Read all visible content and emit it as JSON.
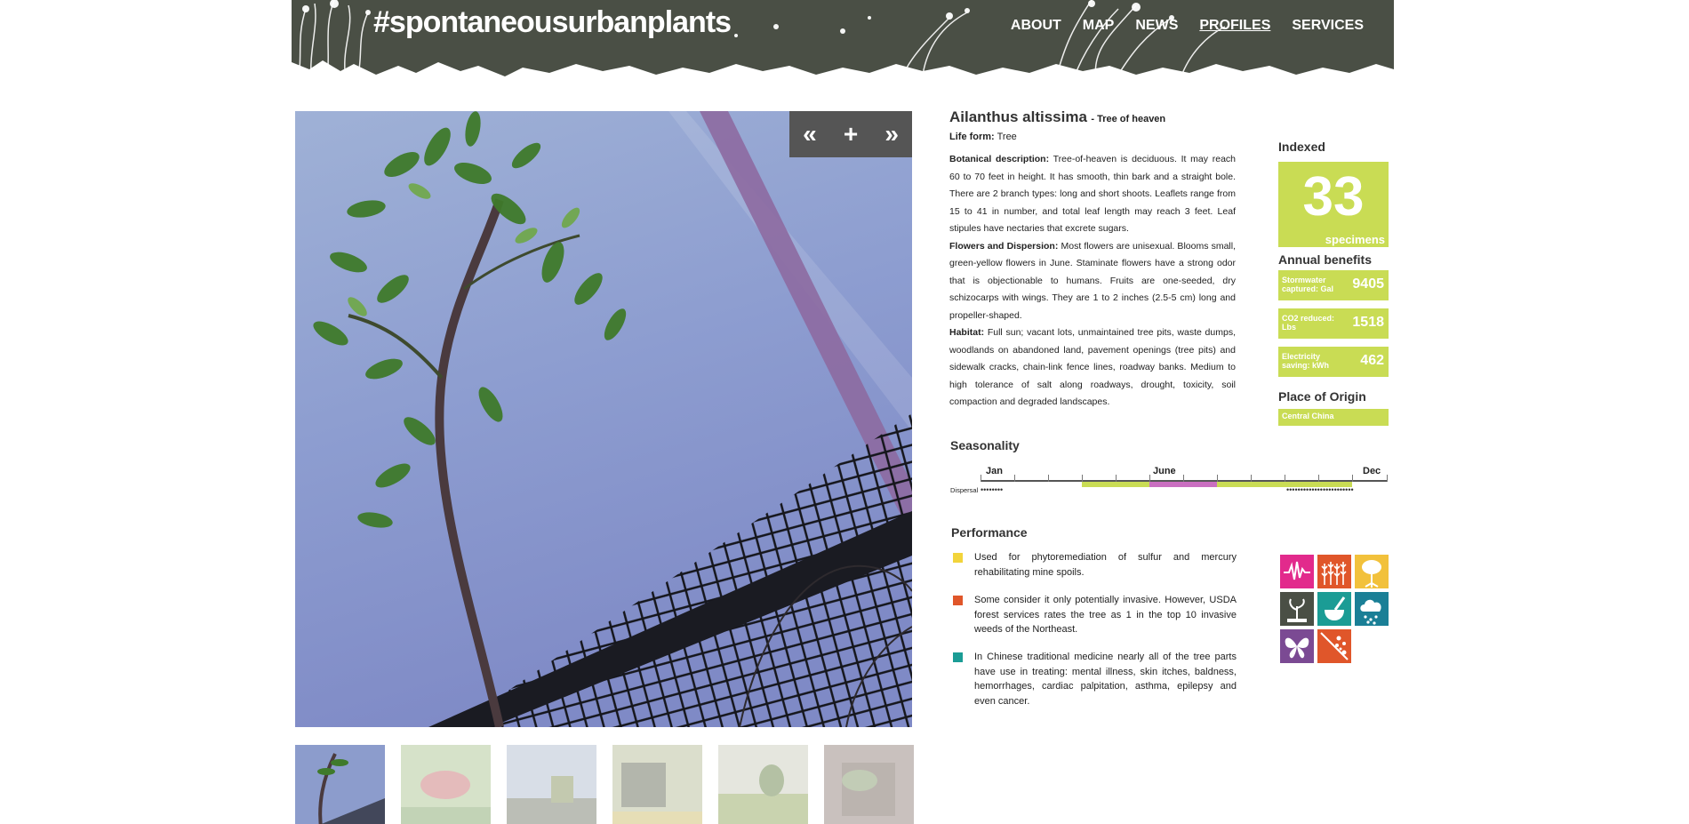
{
  "header": {
    "logo": "#spontaneousurbanplants",
    "nav": [
      {
        "label": "ABOUT",
        "active": false
      },
      {
        "label": "MAP",
        "active": false
      },
      {
        "label": "NEWS",
        "active": false
      },
      {
        "label": "PROFILES",
        "active": true
      },
      {
        "label": "SERVICES",
        "active": false
      }
    ],
    "bg_color": "#4a4f45"
  },
  "gallery": {
    "controls": {
      "prev": "«",
      "zoom": "+",
      "next": "»"
    },
    "thumbnail_count": 6
  },
  "plant": {
    "scientific_name": "Ailanthus altissima",
    "common_name": "- Tree of heaven",
    "life_form_label": "Life form:",
    "life_form": "Tree",
    "botanical_label": "Botanical description:",
    "botanical_text": "Tree-of-heaven is deciduous. It may reach 60 to 70 feet in height. It has smooth, thin bark and a straight bole. There are 2 branch types: long and short shoots. Leaflets range from 15 to 41 in number, and total leaf length may reach 3 feet. Leaf stipules have nectaries that excrete sugars.",
    "flowers_label": "Flowers and Dispersion:",
    "flowers_text": "Most flowers are unisexual. Blooms small, green-yellow flowers in June. Staminate flowers have a strong odor that is objectionable to humans. Fruits are one-seeded, dry schizocarps with wings. They are 1 to 2 inches (2.5-5 cm) long and propeller-shaped.",
    "habitat_label": "Habitat:",
    "habitat_text": "Full sun; vacant lots, unmaintained tree pits, waste dumps, woodlands on abandoned land, pavement openings (tree pits) and sidewalk cracks, chain-link fence lines, roadway banks. Medium to high tolerance of salt along roadways, drought, toxicity, soil compaction and degraded landscapes."
  },
  "seasonality": {
    "title": "Seasonality",
    "months": {
      "jan": "Jan",
      "june": "June",
      "dec": "Dec"
    },
    "dispersal_label": "Dispersal",
    "colors": {
      "green": "#c9dc54",
      "pink": "#c96fc0"
    }
  },
  "performance": {
    "title": "Performance",
    "items": [
      {
        "color": "#f2d43b",
        "text": "Used for phytoremediation of sulfur and mercury rehabilitating mine spoils."
      },
      {
        "color": "#e0562a",
        "text": "Some consider it only potentially invasive. However, USDA forest services rates the tree as 1 in the top 10 invasive weeds of the Northeast."
      },
      {
        "color": "#1b9c95",
        "text": "In Chinese traditional medicine nearly all of the tree parts have use in treating: mental illness, skin itches, baldness, hemorrhages, cardiac palpitation, asthma, epilepsy and even cancer."
      }
    ]
  },
  "sidebar": {
    "indexed_title": "Indexed",
    "indexed_count": "33",
    "indexed_unit": "specimens",
    "benefits_title": "Annual benefits",
    "benefits": [
      {
        "label": "Stormwater captured: Gal",
        "value": "9405"
      },
      {
        "label": "CO2 reduced: Lbs",
        "value": "1518"
      },
      {
        "label": "Electricity saving: kWh",
        "value": "462"
      }
    ],
    "origin_title": "Place of Origin",
    "origin": "Central China",
    "accent": "#c9dc54"
  },
  "icons": [
    {
      "name": "pulse-icon",
      "color": "#e22a8c"
    },
    {
      "name": "crops-icon",
      "color": "#e0562a"
    },
    {
      "name": "tree-icon",
      "color": "#f2c13b"
    },
    {
      "name": "sprout-icon",
      "color": "#4a4f45"
    },
    {
      "name": "mortar-pestle-icon",
      "color": "#1b9c95"
    },
    {
      "name": "rain-cloud-icon",
      "color": "#1a7f96"
    },
    {
      "name": "butterfly-icon",
      "color": "#7b4a93"
    },
    {
      "name": "spread-icon",
      "color": "#e0562a"
    }
  ]
}
